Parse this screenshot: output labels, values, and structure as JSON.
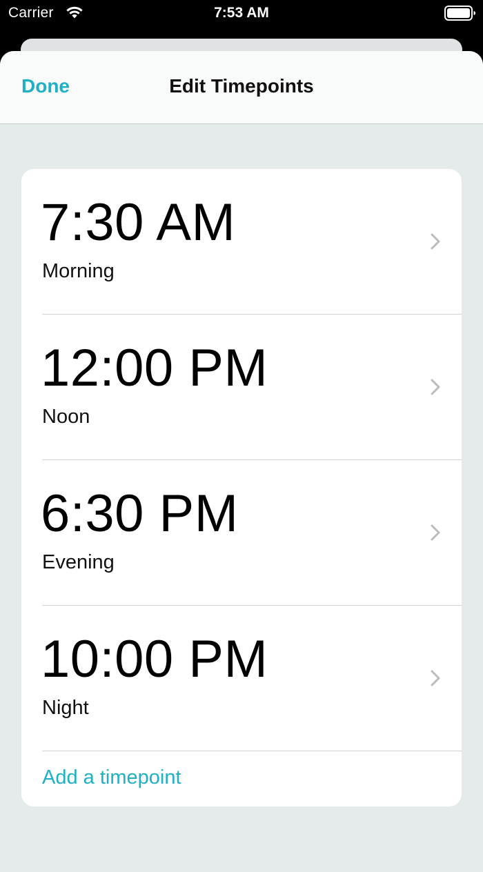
{
  "status_bar": {
    "carrier": "Carrier",
    "time": "7:53 AM",
    "wifi_icon": "wifi-icon",
    "battery_icon": "battery-full-icon"
  },
  "nav": {
    "done_label": "Done",
    "title": "Edit Timepoints"
  },
  "timepoints": [
    {
      "time": "7:30 AM",
      "label": "Morning"
    },
    {
      "time": "12:00 PM",
      "label": "Noon"
    },
    {
      "time": "6:30 PM",
      "label": "Evening"
    },
    {
      "time": "10:00 PM",
      "label": "Night"
    }
  ],
  "add_timepoint_label": "Add a timepoint",
  "colors": {
    "accent": "#1fb0c5",
    "background": "#e5eaea",
    "card": "#ffffff",
    "status_bar": "#000000"
  }
}
